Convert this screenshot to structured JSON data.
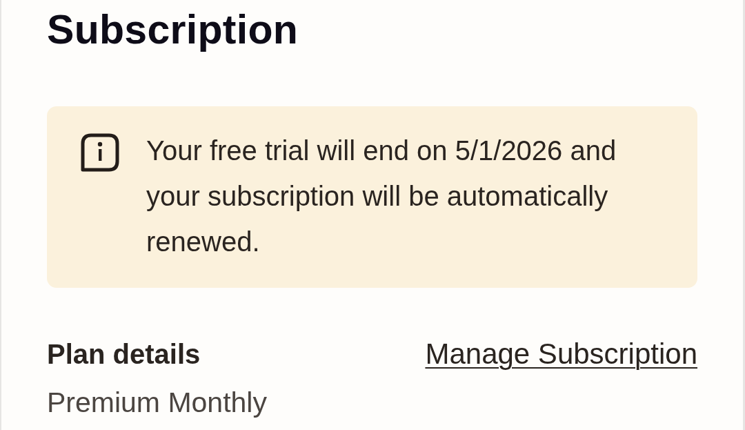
{
  "title": "Subscription",
  "notice": {
    "text": "Your free trial will end on 5/1/2026 and your subscription will be automatically renewed."
  },
  "plan": {
    "heading": "Plan details",
    "link": "Manage Subscription",
    "name": "Premium Monthly"
  }
}
